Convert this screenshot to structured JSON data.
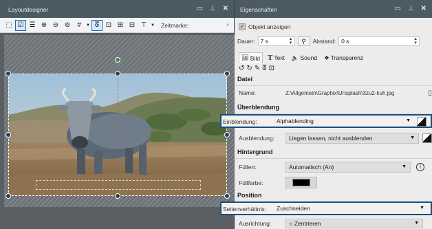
{
  "layout_designer": {
    "title": "Layoutdesigner",
    "toolbar": {
      "zeitmarke_label": "Zeitmarke:"
    }
  },
  "properties": {
    "title": "Eigenschaften",
    "show_object_label": "Objekt anzeigen",
    "dauer_label": "Dauer:",
    "dauer_value": "7 s",
    "abstand_label": "Abstand:",
    "abstand_value": "0 s",
    "tabs": [
      {
        "label": "Bild",
        "icon": "image-icon"
      },
      {
        "label": "Text",
        "icon": "text-icon"
      },
      {
        "label": "Sound",
        "icon": "speaker-icon"
      },
      {
        "label": "Transparenz",
        "icon": "transparency-icon"
      }
    ],
    "datei": {
      "heading": "Datei",
      "name_label": "Name:",
      "name_value": "Z:\\Allgemein\\Graphix\\Unsplash\\3zu2-kuh.jpg"
    },
    "ueberblendung": {
      "heading": "Überblendung",
      "einblendung_label": "Einblendung:",
      "einblendung_value": "Alphablending",
      "ausblendung_label": "Ausblendung:",
      "ausblendung_value": "Liegen lassen, nicht ausblenden"
    },
    "hintergrund": {
      "heading": "Hintergrund",
      "fuellen_label": "Füllen:",
      "fuellen_value": "Automatisch (An)",
      "fuellfarbe_label": "Füllfarbe:",
      "fuellfarbe_color": "#000000"
    },
    "position": {
      "heading": "Position",
      "seitenverhaeltnis_label": "Seitenverhältnis:",
      "seitenverhaeltnis_value": "Zuschneiden",
      "ausrichtung_label": "Ausrichtung:",
      "ausrichtung_value": "Zentrieren"
    }
  },
  "colors": {
    "title_bar": "#4c5a63",
    "highlight_border": "#1d4e78",
    "selection_accent": "#1c66b5"
  }
}
